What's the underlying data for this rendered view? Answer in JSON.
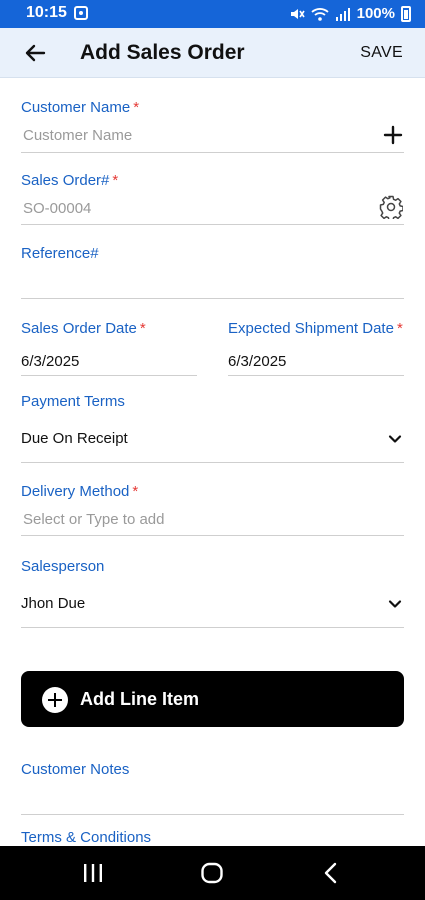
{
  "status_bar": {
    "time": "10:15",
    "battery": "100%"
  },
  "header": {
    "title": "Add Sales Order",
    "save_label": "SAVE"
  },
  "form": {
    "customer_name": {
      "label": "Customer Name",
      "required": "*",
      "placeholder": "Customer Name"
    },
    "sales_order_number": {
      "label": "Sales Order#",
      "required": "*",
      "placeholder": "SO-00004"
    },
    "reference": {
      "label": "Reference#"
    },
    "sales_order_date": {
      "label": "Sales Order Date",
      "required": "*",
      "value": "6/3/2025"
    },
    "expected_shipment_date": {
      "label": "Expected Shipment Date",
      "required": "*",
      "value": "6/3/2025"
    },
    "payment_terms": {
      "label": "Payment Terms",
      "value": "Due On Receipt"
    },
    "delivery_method": {
      "label": "Delivery Method",
      "required": "*",
      "placeholder": "Select or Type to add"
    },
    "salesperson": {
      "label": "Salesperson",
      "value": "Jhon Due"
    }
  },
  "add_line_item": {
    "label": "Add Line Item"
  },
  "customer_notes": {
    "label": "Customer Notes"
  },
  "terms_conditions": {
    "label": "Terms & Conditions"
  },
  "colors": {
    "accent": "#1565d8",
    "label": "#1a62c4",
    "required": "#e53935",
    "header_bg": "#e9f1fb"
  },
  "icons": [
    "back-arrow-icon",
    "add-icon",
    "gear-icon",
    "chevron-down-icon",
    "add-circle-icon",
    "recent-apps-icon",
    "home-icon",
    "nav-back-icon"
  ]
}
